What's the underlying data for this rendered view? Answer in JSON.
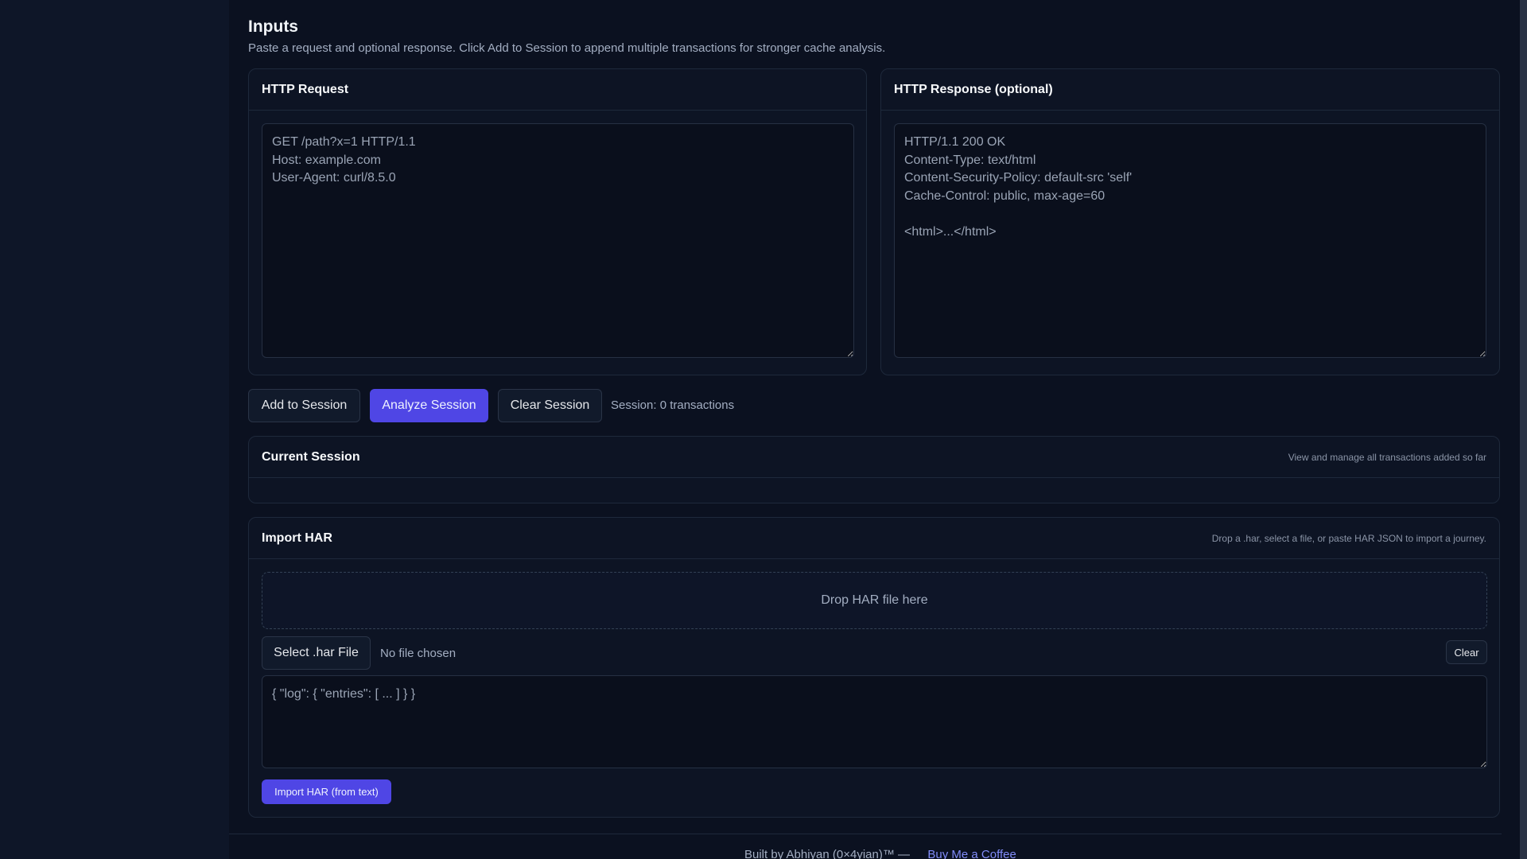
{
  "page": {
    "heading": "Inputs",
    "subtitle": "Paste a request and optional response. Click Add to Session to append multiple transactions for stronger cache analysis."
  },
  "request_panel": {
    "title": "HTTP Request",
    "value": "GET /path?x=1 HTTP/1.1\nHost: example.com\nUser-Agent: curl/8.5.0"
  },
  "response_panel": {
    "title": "HTTP Response (optional)",
    "value": "HTTP/1.1 200 OK\nContent-Type: text/html\nContent-Security-Policy: default-src 'self'\nCache-Control: public, max-age=60\n\n<html>...</html>"
  },
  "actions": {
    "add_label": "Add to Session",
    "analyze_label": "Analyze Session",
    "clear_label": "Clear Session",
    "session_status": "Session: 0 transactions"
  },
  "current_session": {
    "title": "Current Session",
    "hint": "View and manage all transactions added so far"
  },
  "import_har": {
    "title": "Import HAR",
    "hint": "Drop a .har, select a file, or paste HAR JSON to import a journey.",
    "dropzone_label": "Drop HAR file here",
    "select_label": "Select .har File",
    "file_status": "No file chosen",
    "clear_label": "Clear",
    "json_value": "{ \"log\": { \"entries\": [ ... ] } }",
    "import_label": "Import HAR (from text)"
  },
  "footer": {
    "prefix": "Built by Abhiyan (0×4yian)™ —",
    "coffee_icon": "",
    "link_label": "Buy Me a Coffee"
  },
  "colors": {
    "background": "#0b1120",
    "accent": "#4f46e5",
    "link": "#818cf8"
  }
}
